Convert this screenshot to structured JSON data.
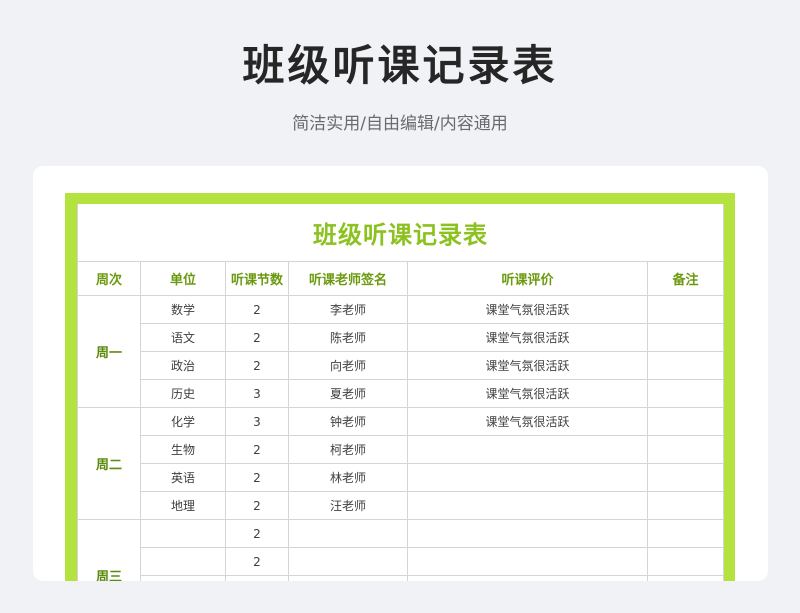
{
  "header": {
    "title": "班级听课记录表",
    "subtitle": "简洁实用/自由编辑/内容通用"
  },
  "sheet": {
    "title": "班级听课记录表",
    "columns": [
      "周次",
      "单位",
      "听课节数",
      "听课老师签名",
      "听课评价",
      "备注"
    ],
    "weeks": [
      {
        "label": "周一",
        "rows": [
          {
            "unit": "数学",
            "count": "2",
            "teacher": "李老师",
            "review": "课堂气氛很活跃",
            "note": ""
          },
          {
            "unit": "语文",
            "count": "2",
            "teacher": "陈老师",
            "review": "课堂气氛很活跃",
            "note": ""
          },
          {
            "unit": "政治",
            "count": "2",
            "teacher": "向老师",
            "review": "课堂气氛很活跃",
            "note": ""
          },
          {
            "unit": "历史",
            "count": "3",
            "teacher": "夏老师",
            "review": "课堂气氛很活跃",
            "note": ""
          }
        ]
      },
      {
        "label": "周二",
        "rows": [
          {
            "unit": "化学",
            "count": "3",
            "teacher": "钟老师",
            "review": "课堂气氛很活跃",
            "note": ""
          },
          {
            "unit": "生物",
            "count": "2",
            "teacher": "柯老师",
            "review": "",
            "note": ""
          },
          {
            "unit": "英语",
            "count": "2",
            "teacher": "林老师",
            "review": "",
            "note": ""
          },
          {
            "unit": "地理",
            "count": "2",
            "teacher": "汪老师",
            "review": "",
            "note": ""
          }
        ]
      },
      {
        "label": "周三",
        "rows": [
          {
            "unit": "",
            "count": "2",
            "teacher": "",
            "review": "",
            "note": ""
          },
          {
            "unit": "",
            "count": "2",
            "teacher": "",
            "review": "",
            "note": ""
          },
          {
            "unit": "",
            "count": "",
            "teacher": "",
            "review": "",
            "note": ""
          },
          {
            "unit": "",
            "count": "",
            "teacher": "",
            "review": "",
            "note": ""
          }
        ]
      }
    ]
  },
  "colors": {
    "accent": "#b4e33f",
    "title_green": "#8cc21f",
    "header_green": "#6b9a10"
  }
}
